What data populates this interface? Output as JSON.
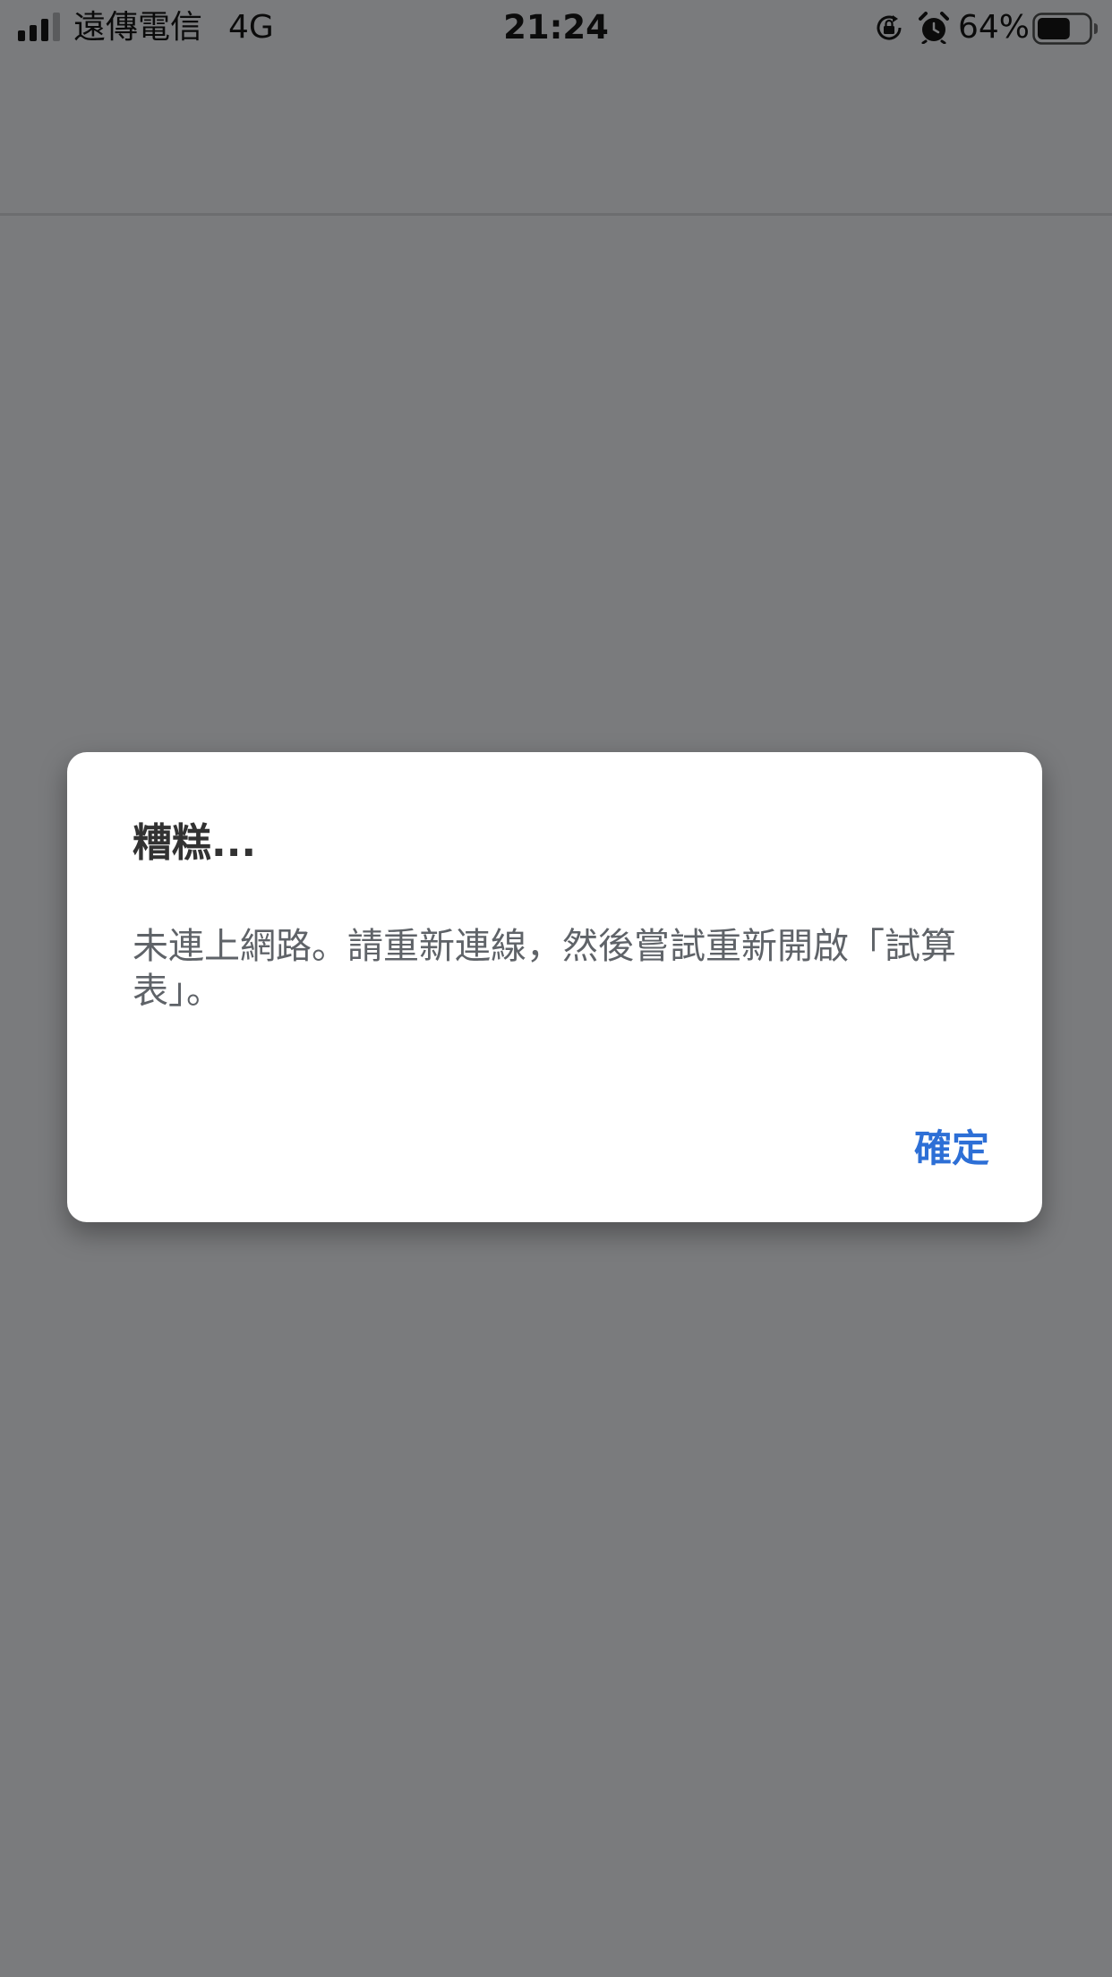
{
  "status_bar": {
    "carrier": "遠傳電信",
    "network": "4G",
    "time": "21:24",
    "battery_percent": "64%",
    "battery_level": 0.64
  },
  "dialog": {
    "title": "糟糕...",
    "message": "未連上網路。請重新連線，然後嘗試重新開啟「試算表」。",
    "ok_label": "確定",
    "ok_color": "#2d6fd6"
  }
}
